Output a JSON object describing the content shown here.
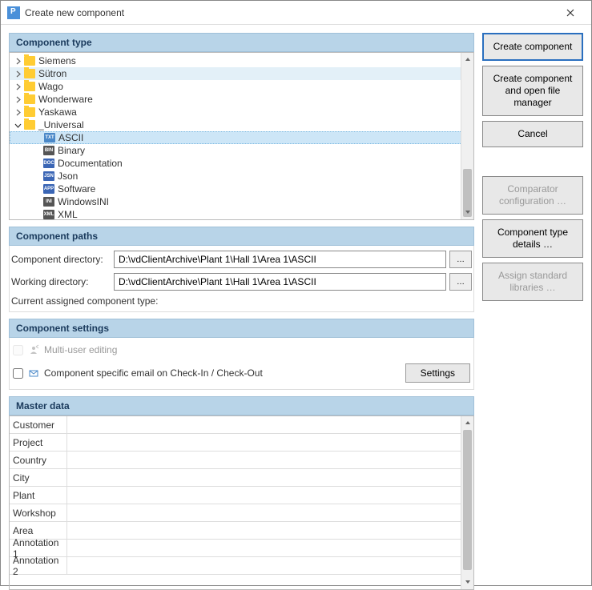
{
  "title": "Create new component",
  "sections": {
    "componentType": "Component type",
    "componentPaths": "Component paths",
    "componentSettings": "Component settings",
    "masterData": "Master data"
  },
  "tree": {
    "folders": [
      {
        "label": "Siemens"
      },
      {
        "label": "Sütron"
      },
      {
        "label": "Wago"
      },
      {
        "label": "Wonderware"
      },
      {
        "label": "Yaskawa"
      }
    ],
    "universal": {
      "label": "_Universal",
      "items": [
        {
          "label": "ASCII",
          "iconText": "TXT",
          "iconColor": "#4a88c8"
        },
        {
          "label": "Binary",
          "iconText": "BIN",
          "iconColor": "#555"
        },
        {
          "label": "Documentation",
          "iconText": "DOC",
          "iconColor": "#3b66b5"
        },
        {
          "label": "Json",
          "iconText": "JSN",
          "iconColor": "#3b66b5"
        },
        {
          "label": "Software",
          "iconText": "APP",
          "iconColor": "#3b66b5"
        },
        {
          "label": "WindowsINI",
          "iconText": "INI",
          "iconColor": "#555"
        },
        {
          "label": "XML",
          "iconText": "XML",
          "iconColor": "#555"
        }
      ]
    }
  },
  "paths": {
    "componentDirLabel": "Component directory:",
    "componentDirValue": "D:\\vdClientArchive\\Plant 1\\Hall 1\\Area 1\\ASCII",
    "workingDirLabel": "Working directory:",
    "workingDirValue": "D:\\vdClientArchive\\Plant 1\\Hall 1\\Area 1\\ASCII",
    "assignedTypeLabel": "Current assigned component type:",
    "assignedTypeValue": ""
  },
  "settings": {
    "multiUser": "Multi-user editing",
    "emailCheck": "Component specific email on Check-In / Check-Out",
    "settingsBtn": "Settings"
  },
  "masterFields": [
    "Customer",
    "Project",
    "Country",
    "City",
    "Plant",
    "Workshop",
    "Area",
    "Annotation 1",
    "Annotation 2"
  ],
  "buttons": {
    "create": "Create component",
    "createOpen": "Create component and open file manager",
    "cancel": "Cancel",
    "comparator": "Comparator configuration …",
    "details": "Component type details …",
    "assign": "Assign standard libraries …"
  }
}
